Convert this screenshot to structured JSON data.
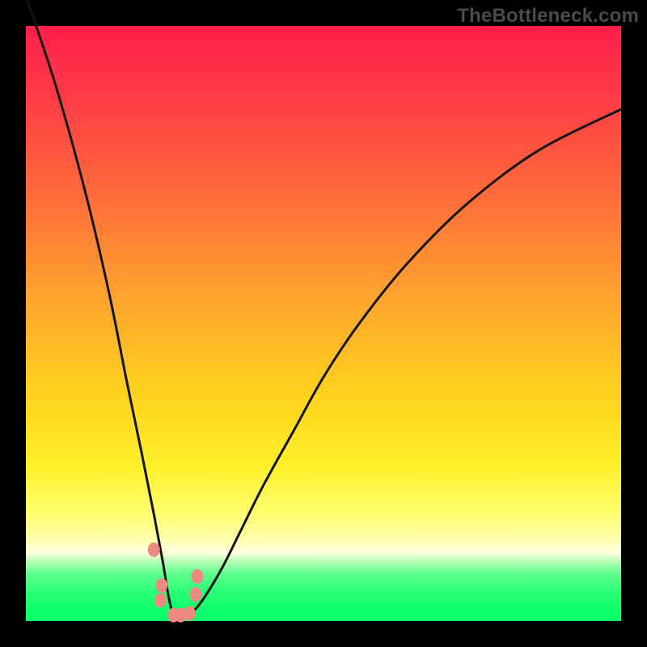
{
  "watermark": "TheBottleneck.com",
  "colors": {
    "frame": "#000000",
    "curve": "#141414",
    "marker": "#ef8a82"
  },
  "chart_data": {
    "type": "line",
    "title": "",
    "xlabel": "",
    "ylabel": "",
    "xlim": [
      0,
      100
    ],
    "ylim": [
      0,
      100
    ],
    "series": [
      {
        "name": "bottleneck-curve",
        "x": [
          0,
          5,
          10,
          14,
          17,
          19.5,
          21.5,
          23,
          24,
          25,
          26.5,
          28,
          30,
          33,
          36,
          40,
          45,
          50,
          56,
          64,
          74,
          86,
          100
        ],
        "y": [
          105,
          90,
          72,
          55,
          40,
          28,
          18,
          10,
          4,
          0.5,
          0.5,
          1.5,
          4,
          9,
          15,
          23,
          32,
          41,
          50,
          60,
          70,
          79,
          86
        ]
      }
    ],
    "markers": [
      {
        "x": 21.5,
        "y": 12
      },
      {
        "x": 22.8,
        "y": 6
      },
      {
        "x": 22.6,
        "y": 3.5
      },
      {
        "x": 24.8,
        "y": 1.0
      },
      {
        "x": 26.0,
        "y": 1.0
      },
      {
        "x": 27.5,
        "y": 1.3
      },
      {
        "x": 28.5,
        "y": 4.5
      },
      {
        "x": 28.8,
        "y": 7.5
      }
    ],
    "grid": false,
    "legend": false
  }
}
